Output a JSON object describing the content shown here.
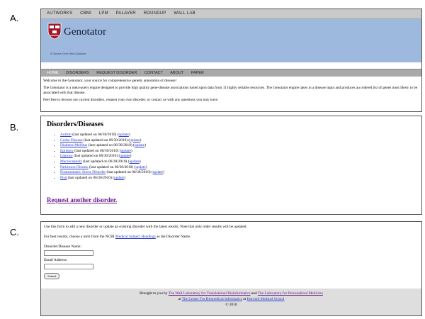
{
  "panel_labels": [
    "A.",
    "B.",
    "C."
  ],
  "top_nav": [
    "AUTWORKS",
    "CBMI",
    "LPM",
    "PALAVER",
    "ROUNDUP",
    "WALL LAB"
  ],
  "brand": {
    "name": "Genotator",
    "tagline": "A Disease-Gene Meta-Database"
  },
  "sub_nav": [
    "HOME",
    "DISORDERS",
    "REQUEST DISORDER",
    "CONTACT",
    "ABOUT",
    "PAPER"
  ],
  "sub_nav_active": "HOME",
  "intro": {
    "p1": "Welcome to the Genotator, your source for comprehensive genetic annotation of disease!",
    "p2": "The Genotator is a meta-query engine designed to provide high quality gene-disease associations based upon data from 11 highly reliable resources. The Genotator engine takes in a disease input and produces an ordered list of genes most likely to be associated with that disease.",
    "p3": "Feel free to browse our current disorders, request your own disorder, or contact us with any questions you may have."
  },
  "disorders": {
    "heading": "Disorders/Diseases",
    "items": [
      {
        "name": "Autism",
        "updated": " (last updated on 06/30/2010) (",
        "update_label": "update",
        "close": ")"
      },
      {
        "name": "Crohn Disease",
        "updated": " (last updated on 06/30/2010) (",
        "update_label": "update",
        "close": ")"
      },
      {
        "name": "Diabetes Mellitus",
        "updated": " (last updated on 06/30/2010) (",
        "update_label": "update",
        "close": ")"
      },
      {
        "name": "Epilepsy",
        "updated": " (last updated on 06/30/2010) (",
        "update_label": "update",
        "close": ")"
      },
      {
        "name": "Leprosy",
        "updated": " (last updated on 06/30/2010) (",
        "update_label": "update",
        "close": ")"
      },
      {
        "name": "Macrocephaly",
        "updated": " (last updated on 06/30/2010) (",
        "update_label": "update",
        "close": ")"
      },
      {
        "name": "Parkinson Disease",
        "updated": " (last updated on 06/30/2010) (",
        "update_label": "update",
        "close": ")"
      },
      {
        "name": "Posttraumatic Stress Disorder",
        "updated": " (last updated on 06/30/2010) (",
        "update_label": "update",
        "close": ")"
      },
      {
        "name": "Ptsd",
        "updated": " (last updated on 06/30/2010) (",
        "update_label": "update",
        "close": ")"
      }
    ],
    "request_link": "Request another disorder."
  },
  "form": {
    "p1": "Use this form to add a new disorder or update an existing disorder with the latest results. Note that only older results will be updated.",
    "p2_prefix": "For best results, choose a term from the NCBI ",
    "p2_link": "Medical Subject Headings",
    "p2_suffix": " as the Disorder Name.",
    "name_label": "Disorder/Disease Name:",
    "name_value": "",
    "email_label": "Email Address:",
    "email_value": "",
    "submit_label": "Submit"
  },
  "footer": {
    "line1_prefix": "Brought to you by ",
    "line1_link1": "The Wall Laboratory for Translational Bioinformatics",
    "line1_mid": " and ",
    "line1_link2": "The Laboratory for Personalized Medicine",
    "line2_prefix": "at ",
    "line2_link1": "The Center For Biomedical Informatics",
    "line2_mid": " at ",
    "line2_link2": "Harvard Medical School",
    "line3": "© 2010"
  },
  "colors": {
    "banner": "#9db9de",
    "link": "#2a3cc9",
    "visited_link": "#6a1a8a",
    "shield": "#a3162a"
  }
}
